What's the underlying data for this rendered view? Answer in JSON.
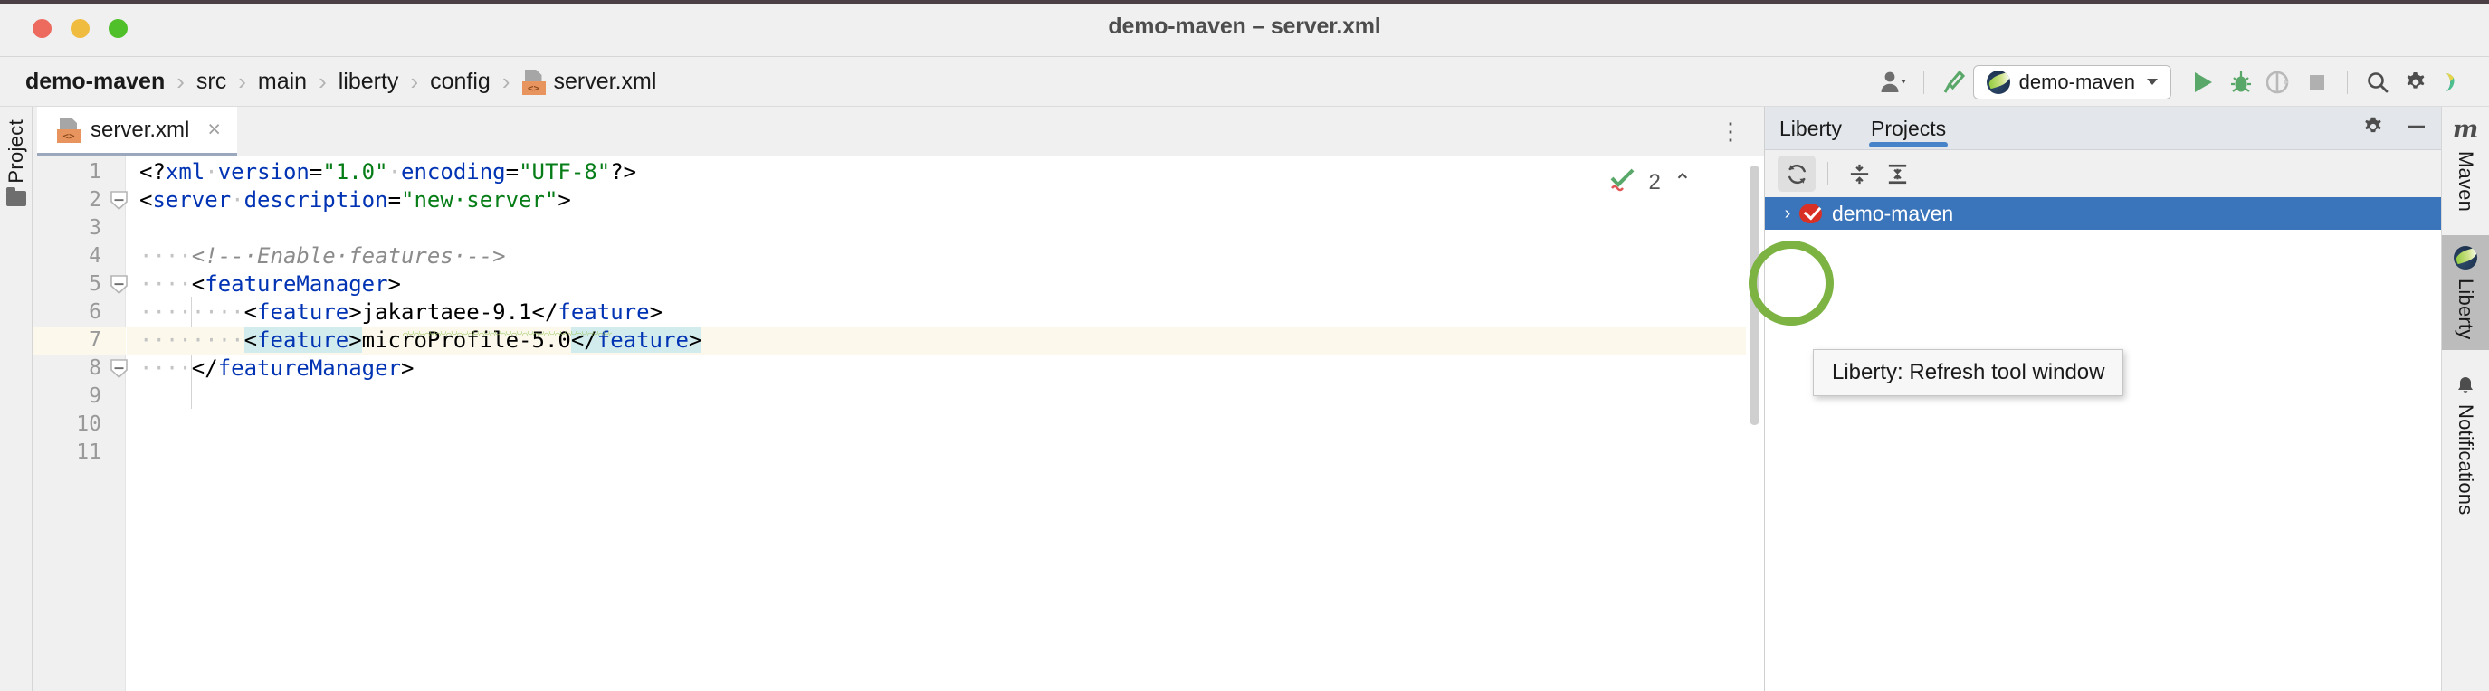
{
  "window": {
    "title": "demo-maven – server.xml",
    "traffic_lights": [
      "close",
      "minimize",
      "zoom"
    ],
    "colors": {
      "close": "#ec6a5e",
      "minimize": "#f0bc40",
      "zoom": "#4fc029"
    }
  },
  "navbar": {
    "breadcrumb": [
      {
        "label": "demo-maven",
        "icon": null,
        "root": true
      },
      {
        "label": "src",
        "icon": null
      },
      {
        "label": "main",
        "icon": null
      },
      {
        "label": "liberty",
        "icon": null
      },
      {
        "label": "config",
        "icon": null
      },
      {
        "label": "server.xml",
        "icon": "xml-file-icon"
      }
    ],
    "separator": "›",
    "toolbar": {
      "account_label": "",
      "build_label": "",
      "run_config": {
        "label": "demo-maven",
        "icon": "liberty-logo"
      },
      "run_label": "",
      "debug_label": "",
      "coverage_label": "",
      "stop_label": "",
      "search_label": "",
      "settings_label": "",
      "assistant_label": ""
    }
  },
  "left_strip": {
    "items": [
      {
        "label": "Project",
        "icon": "folder-icon"
      }
    ]
  },
  "editor": {
    "tab": {
      "label": "server.xml",
      "icon": "xml-file-icon",
      "close": "×",
      "active": true
    },
    "tab_options": "⋮",
    "inspection": {
      "count": "2",
      "icon": "inspection-ok-icon",
      "collapse": "⌃"
    },
    "xml_icon_text": "<>",
    "lines": [
      {
        "n": "1",
        "fold": false,
        "current": false,
        "tokens": [
          {
            "t": "<?",
            "c": "punct"
          },
          {
            "t": "xml",
            "c": "tagname"
          },
          {
            "t": "·",
            "c": "ws"
          },
          {
            "t": "version",
            "c": "attr"
          },
          {
            "t": "=",
            "c": "punct"
          },
          {
            "t": "\"1.0\"",
            "c": "value"
          },
          {
            "t": "·",
            "c": "ws"
          },
          {
            "t": "encoding",
            "c": "attr"
          },
          {
            "t": "=",
            "c": "punct"
          },
          {
            "t": "\"UTF-8\"",
            "c": "value"
          },
          {
            "t": "?>",
            "c": "punct"
          }
        ]
      },
      {
        "n": "2",
        "fold": true,
        "current": false,
        "tokens": [
          {
            "t": "<",
            "c": "punct"
          },
          {
            "t": "server",
            "c": "tagname"
          },
          {
            "t": "·",
            "c": "ws"
          },
          {
            "t": "description",
            "c": "attr"
          },
          {
            "t": "=",
            "c": "punct"
          },
          {
            "t": "\"new·server\"",
            "c": "value"
          },
          {
            "t": ">",
            "c": "punct"
          }
        ]
      },
      {
        "n": "3",
        "fold": false,
        "current": false,
        "tokens": []
      },
      {
        "n": "4",
        "fold": false,
        "current": false,
        "tokens": [
          {
            "t": "····",
            "c": "ws"
          },
          {
            "t": "<!--·Enable·features·-->",
            "c": "comment"
          }
        ]
      },
      {
        "n": "5",
        "fold": true,
        "current": false,
        "tokens": [
          {
            "t": "····",
            "c": "ws"
          },
          {
            "t": "<",
            "c": "punct"
          },
          {
            "t": "featureManager",
            "c": "tagname"
          },
          {
            "t": ">",
            "c": "punct"
          }
        ]
      },
      {
        "n": "6",
        "fold": false,
        "current": false,
        "tokens": [
          {
            "t": "········",
            "c": "ws"
          },
          {
            "t": "<",
            "c": "punct"
          },
          {
            "t": "feature",
            "c": "tagname"
          },
          {
            "t": ">",
            "c": "punct"
          },
          {
            "t": "jakartaee-9.1",
            "c": "text"
          },
          {
            "t": "</",
            "c": "punct"
          },
          {
            "t": "feature",
            "c": "tagname"
          },
          {
            "t": ">",
            "c": "punct"
          }
        ]
      },
      {
        "n": "7",
        "fold": false,
        "current": true,
        "tokens": [
          {
            "t": "········",
            "c": "ws"
          },
          {
            "t": "<",
            "c": "punct",
            "hl": true
          },
          {
            "t": "feature",
            "c": "tagname",
            "hl": true
          },
          {
            "t": ">",
            "c": "punct",
            "hl": true
          },
          {
            "t": "microProfile-5.0",
            "c": "text"
          },
          {
            "t": "</",
            "c": "punct",
            "hl": true
          },
          {
            "t": "feature",
            "c": "tagname",
            "hl": true
          },
          {
            "t": ">",
            "c": "punct",
            "hl": true
          }
        ]
      },
      {
        "n": "8",
        "fold": true,
        "current": false,
        "tokens": [
          {
            "t": "····",
            "c": "ws"
          },
          {
            "t": "</",
            "c": "punct"
          },
          {
            "t": "featureManager",
            "c": "tagname"
          },
          {
            "t": ">",
            "c": "punct"
          }
        ]
      },
      {
        "n": "9",
        "fold": false,
        "current": false,
        "tokens": []
      },
      {
        "n": "10",
        "fold": false,
        "current": false,
        "tokens": []
      },
      {
        "n": "11",
        "fold": false,
        "current": false,
        "tokens": []
      }
    ],
    "syntax_colors": {
      "tagname": "#0033b3",
      "attr": "#0033b3",
      "value": "#067d17",
      "comment": "#8c8c8c",
      "text": "#000000",
      "current_line_bg": "#fcf9ec",
      "tag_pair_hl": "#d2ebed",
      "warning_squiggle": "#9fc96a"
    }
  },
  "tool_window": {
    "tabs": [
      {
        "label": "Liberty",
        "active": false
      },
      {
        "label": "Projects",
        "active": true
      }
    ],
    "header_actions": [
      {
        "name": "settings-icon",
        "label": ""
      },
      {
        "name": "minimize-icon",
        "label": "−"
      }
    ],
    "toolbar": [
      {
        "name": "refresh-button",
        "label": "",
        "hover": true
      },
      {
        "name": "collapse-all-button",
        "label": ""
      },
      {
        "name": "expand-all-button",
        "label": ""
      }
    ],
    "tree": [
      {
        "label": "demo-maven",
        "arrow": "›",
        "icon": "maven-icon",
        "selected": true
      }
    ],
    "tooltip": {
      "text": "Liberty: Refresh tool window"
    },
    "accent_color": "#4683c8",
    "selection_color": "#3a74ba"
  },
  "annotation": {
    "shape": "circle",
    "color": "#7cb342",
    "target": "refresh-button"
  },
  "right_strip": {
    "items": [
      {
        "label": "Maven",
        "icon": "maven-m-icon",
        "active": false
      },
      {
        "label": "Liberty",
        "icon": "liberty-logo",
        "active": true
      },
      {
        "label": "Notifications",
        "icon": "bell-icon",
        "active": false
      }
    ]
  }
}
